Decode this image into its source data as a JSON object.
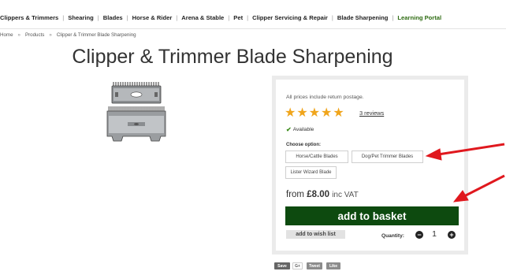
{
  "nav": {
    "items": [
      {
        "label": "Clippers & Trimmers"
      },
      {
        "label": "Shearing"
      },
      {
        "label": "Blades"
      },
      {
        "label": "Horse & Rider"
      },
      {
        "label": "Arena & Stable"
      },
      {
        "label": "Pet"
      },
      {
        "label": "Clipper Servicing & Repair"
      },
      {
        "label": "Blade Sharpening"
      },
      {
        "label": "Learning Portal"
      }
    ],
    "separator": "|",
    "highlight_color": "#2e6b12"
  },
  "breadcrumb": {
    "items": [
      "Home",
      "Products",
      "Clipper & Trimmer Blade Sharpening"
    ],
    "separator": "»"
  },
  "page_title": "Clipper & Trimmer Blade Sharpening",
  "product_image": {
    "alt_icon": "clipper-blade-image"
  },
  "buybox": {
    "postage_note": "All prices include return postage.",
    "rating": {
      "stars": 5,
      "max": 5,
      "star_glyph": "★",
      "reviews_link": "3 reviews",
      "star_color": "#f0a51c"
    },
    "availability": {
      "icon": "✔",
      "text": "Available",
      "color": "#3d8d1c"
    },
    "choose_label": "Choose option:",
    "options": [
      "Horse/Cattle Blades",
      "Dog/Pet Trimmer Blades",
      "Lister Wizard Blade"
    ],
    "price": {
      "prefix": "from",
      "amount": "£8.00",
      "suffix": "inc VAT"
    },
    "add_to_basket": "add to basket",
    "button_color": "#0d4a0f",
    "add_to_wishlist": "add to wish list",
    "quantity": {
      "label": "Quantity:",
      "value": "1",
      "minus": "−",
      "plus": "+"
    }
  },
  "share": {
    "save": "Save",
    "gplus": "G+",
    "tweet": "Tweet",
    "like": "Like"
  },
  "annotation_color": "#e0181e"
}
